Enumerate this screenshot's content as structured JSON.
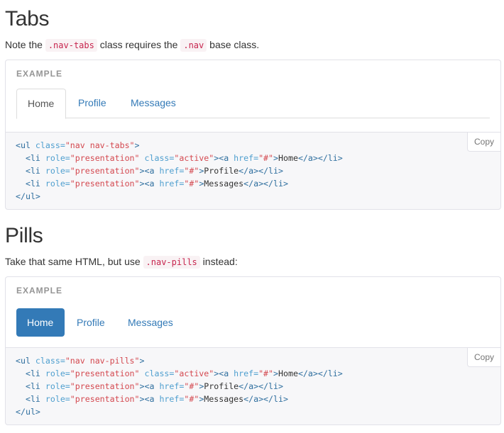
{
  "tabs_section": {
    "title": "Tabs",
    "desc_pre": "Note the ",
    "desc_code1": ".nav-tabs",
    "desc_mid": " class requires the ",
    "desc_code2": ".nav",
    "desc_post": " base class.",
    "example_label": "EXAMPLE",
    "nav": [
      "Home",
      "Profile",
      "Messages"
    ],
    "copy_label": "Copy",
    "code": {
      "l1": [
        "<ul ",
        "class=",
        "\"nav nav-tabs\"",
        ">"
      ],
      "l2": [
        "  <li ",
        "role=",
        "\"presentation\"",
        " class=",
        "\"active\"",
        "><a ",
        "href=",
        "\"#\"",
        ">",
        "Home",
        "</a></li>"
      ],
      "l3": [
        "  <li ",
        "role=",
        "\"presentation\"",
        "><a ",
        "href=",
        "\"#\"",
        ">",
        "Profile",
        "</a></li>"
      ],
      "l4": [
        "  <li ",
        "role=",
        "\"presentation\"",
        "><a ",
        "href=",
        "\"#\"",
        ">",
        "Messages",
        "</a></li>"
      ],
      "l5": [
        "</ul>"
      ]
    }
  },
  "pills_section": {
    "title": "Pills",
    "desc_pre": "Take that same HTML, but use ",
    "desc_code": ".nav-pills",
    "desc_post": " instead:",
    "example_label": "EXAMPLE",
    "nav": [
      "Home",
      "Profile",
      "Messages"
    ],
    "copy_label": "Copy",
    "code": {
      "l1": [
        "<ul ",
        "class=",
        "\"nav nav-pills\"",
        ">"
      ],
      "l2": [
        "  <li ",
        "role=",
        "\"presentation\"",
        " class=",
        "\"active\"",
        "><a ",
        "href=",
        "\"#\"",
        ">",
        "Home",
        "</a></li>"
      ],
      "l3": [
        "  <li ",
        "role=",
        "\"presentation\"",
        "><a ",
        "href=",
        "\"#\"",
        ">",
        "Profile",
        "</a></li>"
      ],
      "l4": [
        "  <li ",
        "role=",
        "\"presentation\"",
        "><a ",
        "href=",
        "\"#\"",
        ">",
        "Messages",
        "</a></li>"
      ],
      "l5": [
        "</ul>"
      ]
    }
  }
}
